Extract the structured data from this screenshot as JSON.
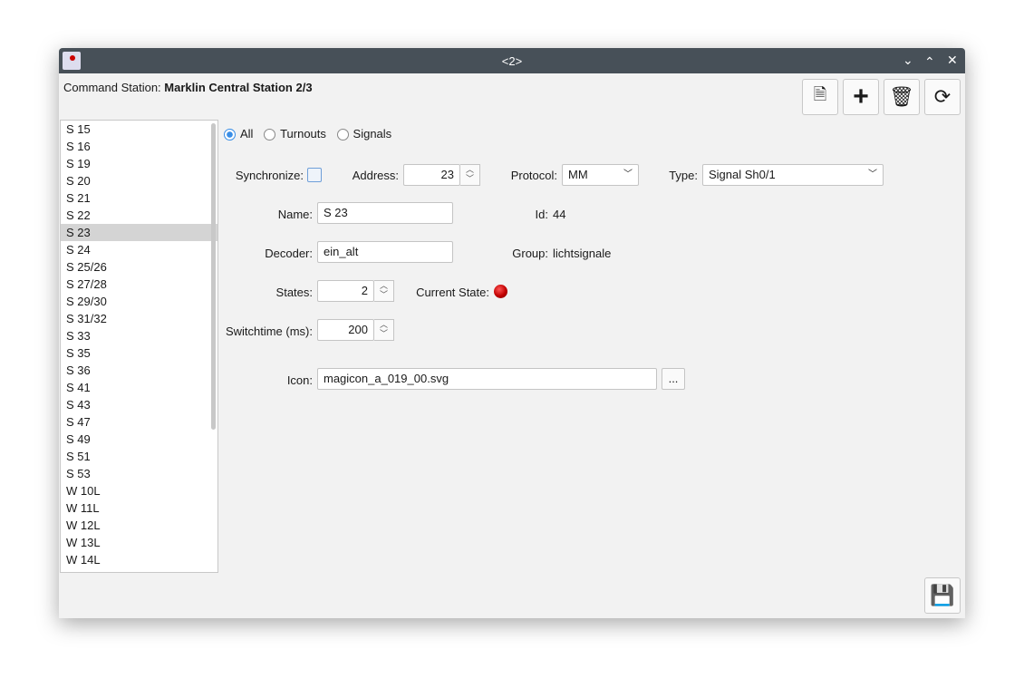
{
  "window": {
    "title": "<2>"
  },
  "header": {
    "station_label": "Command Station:",
    "station_value": "Marklin Central Station 2/3"
  },
  "toolbar": [
    {
      "name": "synchronize-button",
      "icon": "document-sync-icon"
    },
    {
      "name": "add-button",
      "icon": "plus-icon"
    },
    {
      "name": "delete-button",
      "icon": "trash-icon"
    },
    {
      "name": "refresh-button",
      "icon": "refresh-icon"
    }
  ],
  "list": {
    "items": [
      "S 15",
      "S 16",
      "S 19",
      "S 20",
      "S 21",
      "S 22",
      "S 23",
      "S 24",
      "S 25/26",
      "S 27/28",
      "S 29/30",
      "S 31/32",
      "S 33",
      "S 35",
      "S 36",
      "S 41",
      "S 43",
      "S 47",
      "S 49",
      "S 51",
      "S 53",
      "W 10L",
      "W 11L",
      "W 12L",
      "W 13L",
      "W 14L"
    ],
    "selected": "S 23"
  },
  "filter": {
    "all": "All",
    "turnouts": "Turnouts",
    "signals": "Signals",
    "selected": "All"
  },
  "form": {
    "synchronize_label": "Synchronize:",
    "synchronize_checked": false,
    "address_label": "Address:",
    "address": "23",
    "protocol_label": "Protocol:",
    "protocol": "MM",
    "type_label": "Type:",
    "type": "Signal Sh0/1",
    "name_label": "Name:",
    "name": "S 23",
    "id_label": "Id:",
    "id": "44",
    "decoder_label": "Decoder:",
    "decoder": "ein_alt",
    "group_label": "Group:",
    "group": "lichtsignale",
    "states_label": "States:",
    "states": "2",
    "current_state_label": "Current State:",
    "current_state_color": "#c00000",
    "switchtime_label": "Switchtime (ms):",
    "switchtime": "200",
    "icon_label": "Icon:",
    "icon": "magicon_a_019_00.svg",
    "browse": "..."
  }
}
